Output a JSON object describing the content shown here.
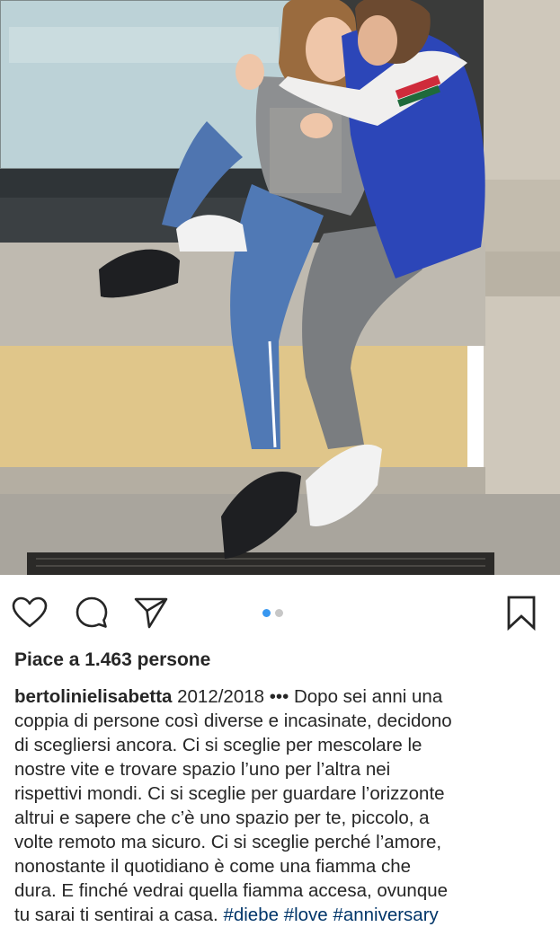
{
  "post": {
    "photo": {
      "description_icon": "photo",
      "colors": {
        "window": "#bdd3d8",
        "wall_yellow": "#e2c98a",
        "stone": "#c4c0b6",
        "jeans": "#4f75b0",
        "jacket": "#2d46b8"
      }
    },
    "actions": {
      "like_icon": "heart-icon",
      "comment_icon": "comment-icon",
      "share_icon": "share-icon",
      "save_icon": "bookmark-icon",
      "carousel_total": 2,
      "carousel_active": 1,
      "accent_color": "#3897f0"
    },
    "likes_text": "Piace a 1.463 persone",
    "caption": {
      "username": "bertolinielisabetta",
      "first_line_rest": " 2012/2018 ••• Dopo sei anni una",
      "lines": [
        "coppia di persone così diverse e incasinate, decidono",
        "di scegliersi ancora. Ci si sceglie per mescolare le",
        "nostre vite e trovare spazio l’uno per l’altra nei",
        "rispettivi mondi. Ci si sceglie per guardare l’orizzonte",
        "altrui e sapere che c’è uno spazio per te, piccolo, a",
        "volte remoto ma sicuro. Ci si sceglie perché l’amore,",
        "nonostante il quotidiano è come una fiamma che",
        "dura. E finché vedrai quella fiamma accesa, ovunque"
      ],
      "last_line_text": "tu sarai ti sentirai a casa. ",
      "hashtags": [
        "#diebe",
        "#love",
        "#anniversary"
      ]
    }
  }
}
